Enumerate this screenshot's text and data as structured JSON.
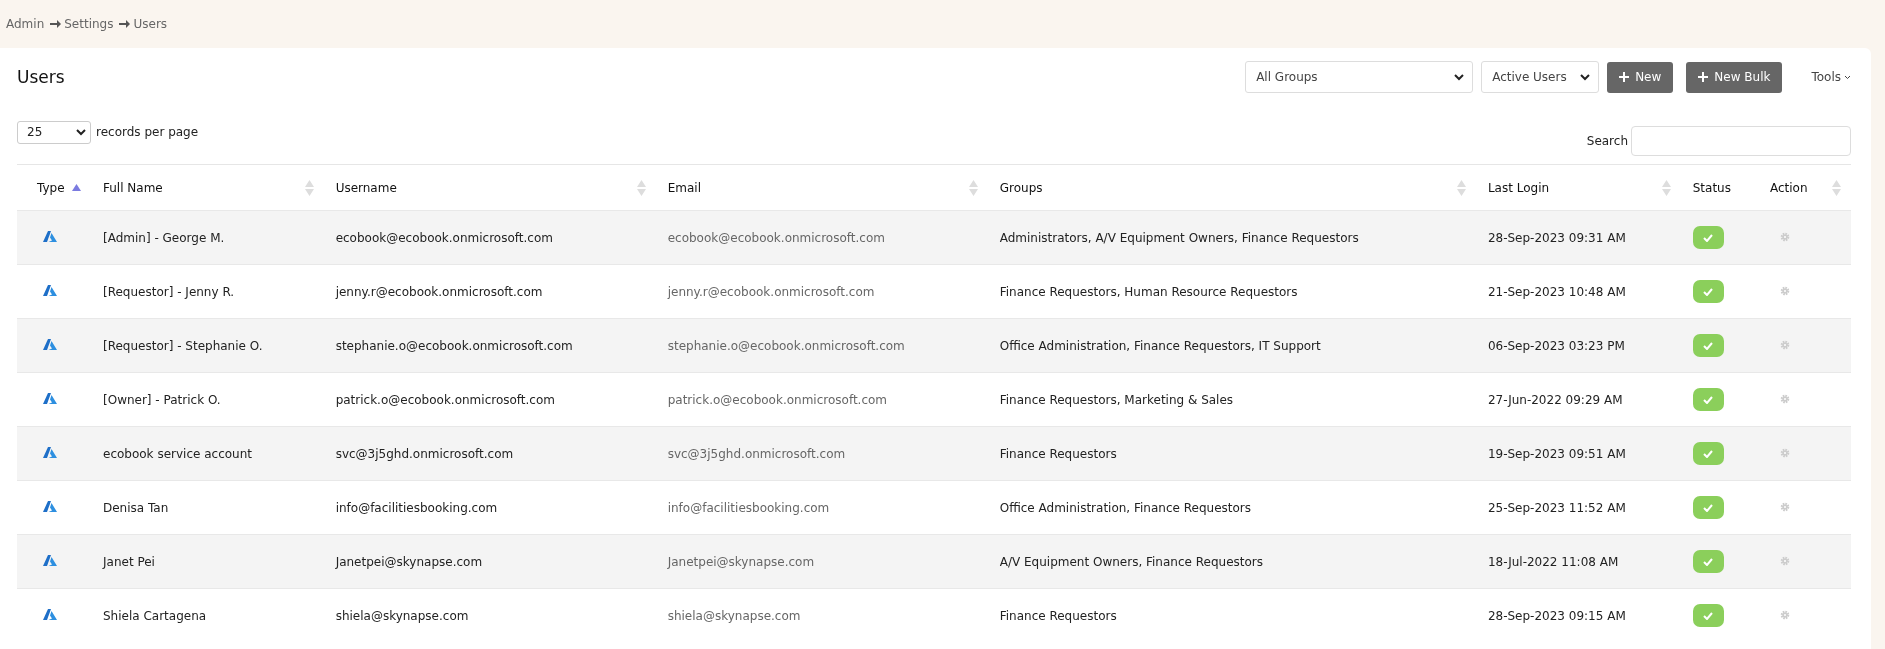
{
  "breadcrumb": [
    "Admin",
    "Settings",
    "Users"
  ],
  "page": {
    "title": "Users"
  },
  "toolbar": {
    "group_filter": "All Groups",
    "user_filter": "Active Users",
    "buttons": [
      {
        "label": "New"
      },
      {
        "label": "New Bulk"
      }
    ],
    "tools": "Tools"
  },
  "page_size": {
    "value": "25",
    "label": "records per page"
  },
  "search": {
    "label": "Search"
  },
  "table": {
    "columns": [
      {
        "label": "Type",
        "sortable": true,
        "sorted": true
      },
      {
        "label": "Full Name",
        "sortable": true,
        "sorted": false
      },
      {
        "label": "Username",
        "sortable": true,
        "sorted": false
      },
      {
        "label": "Email",
        "sortable": true,
        "sorted": false
      },
      {
        "label": "Groups",
        "sortable": true,
        "sorted": false
      },
      {
        "label": "Last Login",
        "sortable": true,
        "sorted": false
      },
      {
        "label": "Status",
        "sortable": false
      },
      {
        "label": "Action",
        "sortable": true,
        "sorted": false
      }
    ],
    "rows": [
      {
        "full_name": "[Admin] - George M.",
        "username": "ecobook@ecobook.onmicrosoft.com",
        "email": "ecobook@ecobook.onmicrosoft.com",
        "groups": "Administrators, A/V Equipment Owners, Finance Requestors",
        "last_login": "28-Sep-2023 09:31 AM",
        "active": true
      },
      {
        "full_name": "[Requestor] - Jenny R.",
        "username": "jenny.r@ecobook.onmicrosoft.com",
        "email": "jenny.r@ecobook.onmicrosoft.com",
        "groups": "Finance Requestors, Human Resource Requestors",
        "last_login": "21-Sep-2023 10:48 AM",
        "active": true
      },
      {
        "full_name": "[Requestor] - Stephanie O.",
        "username": "stephanie.o@ecobook.onmicrosoft.com",
        "email": "stephanie.o@ecobook.onmicrosoft.com",
        "groups": "Office Administration, Finance Requestors, IT Support",
        "last_login": "06-Sep-2023 03:23 PM",
        "active": true
      },
      {
        "full_name": "[Owner] - Patrick O.",
        "username": "patrick.o@ecobook.onmicrosoft.com",
        "email": "patrick.o@ecobook.onmicrosoft.com",
        "groups": "Finance Requestors, Marketing & Sales",
        "last_login": "27-Jun-2022 09:29 AM",
        "active": true
      },
      {
        "full_name": "ecobook service account",
        "username": "svc@3j5ghd.onmicrosoft.com",
        "email": "svc@3j5ghd.onmicrosoft.com",
        "groups": "Finance Requestors",
        "last_login": "19-Sep-2023 09:51 AM",
        "active": true
      },
      {
        "full_name": "Denisa Tan",
        "username": "info@facilitiesbooking.com",
        "email": "info@facilitiesbooking.com",
        "groups": "Office Administration, Finance Requestors",
        "last_login": "25-Sep-2023 11:52 AM",
        "active": true
      },
      {
        "full_name": "Janet Pei",
        "username": "Janetpei@skynapse.com",
        "email": "Janetpei@skynapse.com",
        "groups": "A/V Equipment Owners, Finance Requestors",
        "last_login": "18-Jul-2022 11:08 AM",
        "active": true
      },
      {
        "full_name": "Shiela Cartagena",
        "username": "shiela@skynapse.com",
        "email": "shiela@skynapse.com",
        "groups": "Finance Requestors",
        "last_login": "28-Sep-2023 09:15 AM",
        "active": true
      }
    ]
  }
}
